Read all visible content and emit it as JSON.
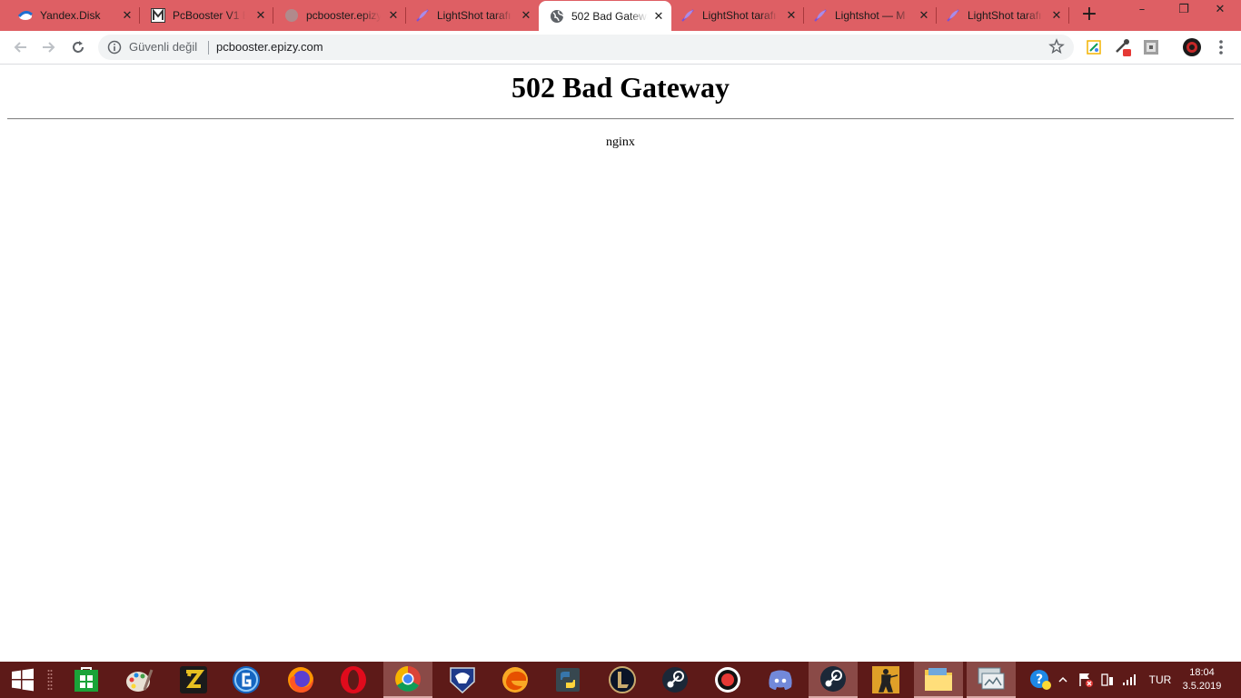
{
  "browser": {
    "tabs": [
      {
        "title": "Yandex.Disk",
        "icon": "yandex-disk-icon",
        "active": false
      },
      {
        "title": "PcBooster V1 B",
        "icon": "m-logo-icon",
        "active": false
      },
      {
        "title": "pcbooster.epizy",
        "icon": "globe-loading-icon",
        "active": false
      },
      {
        "title": "LightShot tarafı",
        "icon": "feather-icon",
        "active": false
      },
      {
        "title": "502 Bad Gatewa",
        "icon": "globe-icon",
        "active": true
      },
      {
        "title": "LightShot tarafı",
        "icon": "feather-icon",
        "active": false
      },
      {
        "title": "Lightshot — M",
        "icon": "feather-icon",
        "active": false
      },
      {
        "title": "LightShot tarafı",
        "icon": "feather-icon",
        "active": false
      }
    ],
    "tab_close_glyph": "✕",
    "new_tab_glyph": "+",
    "window_controls": {
      "minimize": "–",
      "restore": "❐",
      "close": "✕"
    },
    "address_bar": {
      "security_label": "Güvenli değil",
      "url": "pcbooster.epizy.com"
    }
  },
  "page": {
    "heading": "502 Bad Gateway",
    "server": "nginx"
  },
  "taskbar": {
    "apps": [
      "start",
      "task-view",
      "microsoft-store",
      "paint",
      "filezilla",
      "app-g",
      "firefox",
      "opera",
      "chrome",
      "rocket-league",
      "edge-canary",
      "python",
      "league-of-legends",
      "steam",
      "recorder",
      "discord",
      "steam-active",
      "counter-strike",
      "file-explorer",
      "remote-desktop"
    ],
    "tray": {
      "language": "TUR",
      "time": "18:04",
      "date": "3.5.2019"
    }
  },
  "colors": {
    "tabstrip": "#de5f64",
    "taskbar": "#5d1a18"
  }
}
